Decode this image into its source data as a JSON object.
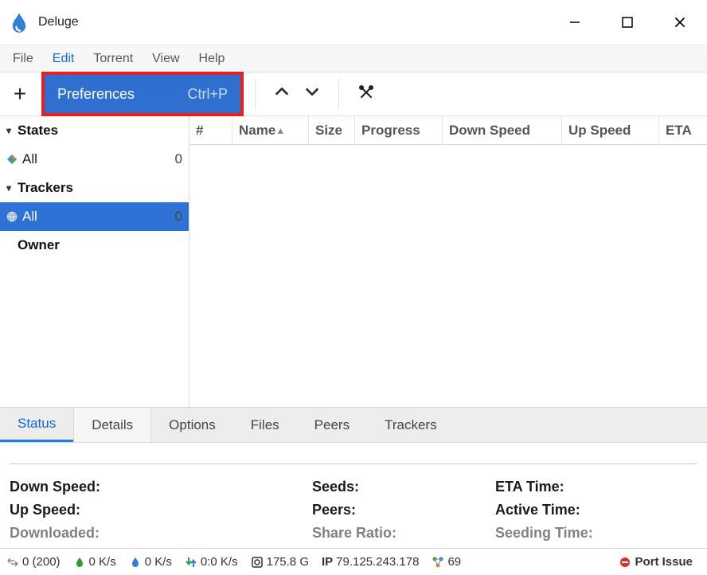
{
  "titlebar": {
    "title": "Deluge"
  },
  "menu": {
    "items": [
      "File",
      "Edit",
      "Torrent",
      "View",
      "Help"
    ],
    "active_index": 1
  },
  "toolbar": {
    "preferences_label": "Preferences",
    "preferences_shortcut": "Ctrl+P"
  },
  "sidebar": {
    "groups": [
      {
        "label": "States",
        "expanded": true,
        "items": [
          {
            "label": "All",
            "count": "0",
            "selected": false
          }
        ]
      },
      {
        "label": "Trackers",
        "expanded": true,
        "items": [
          {
            "label": "All",
            "count": "0",
            "selected": true
          }
        ]
      },
      {
        "label": "Owner",
        "expanded": true,
        "items": []
      }
    ]
  },
  "columns": {
    "num": "#",
    "name": "Name",
    "size": "Size",
    "progress": "Progress",
    "down": "Down Speed",
    "up": "Up Speed",
    "eta": "ETA"
  },
  "tabs": [
    "Status",
    "Details",
    "Options",
    "Files",
    "Peers",
    "Trackers"
  ],
  "details": {
    "row1": {
      "a": "Down Speed:",
      "b": "Seeds:",
      "c": "ETA Time:"
    },
    "row2": {
      "a": "Up Speed:",
      "b": "Peers:",
      "c": "Active Time:"
    },
    "row3": {
      "a": "Downloaded:",
      "b": "Share Ratio:",
      "c": "Seeding Time:"
    }
  },
  "status": {
    "connections": "0 (200)",
    "down_rate": "0 K/s",
    "up_rate": "0 K/s",
    "protocol": "0:0 K/s",
    "disk": "175.8 G",
    "ip_label": "IP",
    "ip": "79.125.243.178",
    "dht": "69",
    "port_issue": "Port Issue"
  }
}
